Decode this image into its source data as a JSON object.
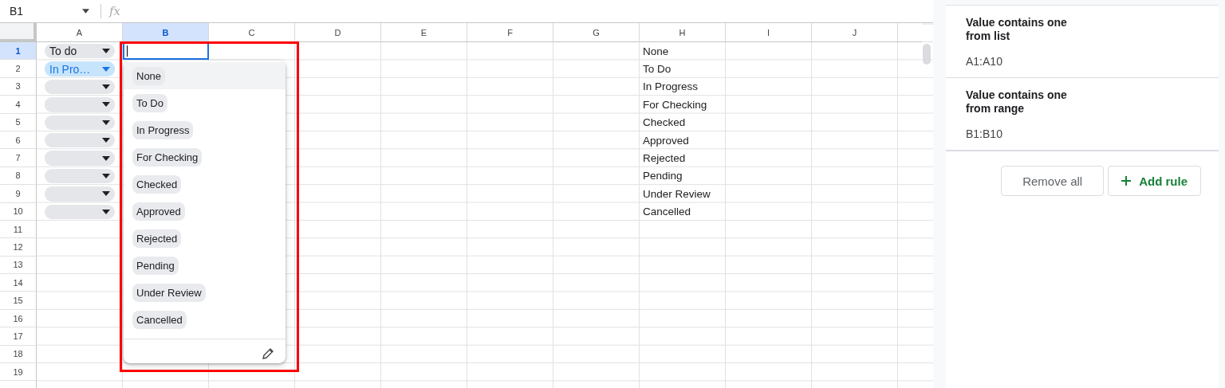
{
  "name_box": {
    "value": "B1"
  },
  "formula_bar": {
    "icon": "fx"
  },
  "columns": [
    {
      "label": "A",
      "selected": false
    },
    {
      "label": "B",
      "selected": true
    },
    {
      "label": "C",
      "selected": false
    },
    {
      "label": "D",
      "selected": false
    },
    {
      "label": "E",
      "selected": false
    },
    {
      "label": "F",
      "selected": false
    },
    {
      "label": "G",
      "selected": false
    },
    {
      "label": "H",
      "selected": false
    },
    {
      "label": "I",
      "selected": false
    },
    {
      "label": "J",
      "selected": false
    }
  ],
  "rows": [
    {
      "label": "1",
      "selected": true,
      "chip": {
        "value": "To do",
        "color": "#e4e6ea",
        "kind": "plain"
      },
      "editing": true,
      "h": "None"
    },
    {
      "label": "2",
      "selected": false,
      "chip": {
        "value": "In Pro…",
        "color": "#c6e4fb",
        "kind": "accent"
      },
      "editing": false,
      "h": "To Do"
    },
    {
      "label": "3",
      "selected": false,
      "chip": {
        "color": "#e4e6ea",
        "kind": "plain"
      },
      "editing": false,
      "h": "In Progress"
    },
    {
      "label": "4",
      "selected": false,
      "chip": {
        "color": "#e4e6ea",
        "kind": "plain"
      },
      "editing": false,
      "h": "For Checking"
    },
    {
      "label": "5",
      "selected": false,
      "chip": {
        "color": "#e4e6ea",
        "kind": "plain"
      },
      "editing": false,
      "h": "Checked"
    },
    {
      "label": "6",
      "selected": false,
      "chip": {
        "color": "#e4e6ea",
        "kind": "plain"
      },
      "editing": false,
      "h": "Approved"
    },
    {
      "label": "7",
      "selected": false,
      "chip": {
        "color": "#e4e6ea",
        "kind": "plain"
      },
      "editing": false,
      "h": "Rejected"
    },
    {
      "label": "8",
      "selected": false,
      "chip": {
        "color": "#e4e6ea",
        "kind": "plain"
      },
      "editing": false,
      "h": "Pending"
    },
    {
      "label": "9",
      "selected": false,
      "chip": {
        "color": "#e4e6ea",
        "kind": "plain"
      },
      "editing": false,
      "h": "Under Review"
    },
    {
      "label": "10",
      "selected": false,
      "chip": {
        "color": "#e4e6ea",
        "kind": "plain"
      },
      "editing": false,
      "h": "Cancelled"
    },
    {
      "label": "11",
      "selected": false,
      "editing": false
    },
    {
      "label": "12",
      "selected": false,
      "editing": false
    },
    {
      "label": "13",
      "selected": false,
      "editing": false
    },
    {
      "label": "14",
      "selected": false,
      "editing": false
    },
    {
      "label": "15",
      "selected": false,
      "editing": false
    },
    {
      "label": "16",
      "selected": false,
      "editing": false
    },
    {
      "label": "17",
      "selected": false,
      "editing": false
    },
    {
      "label": "18",
      "selected": false,
      "editing": false
    },
    {
      "label": "19",
      "selected": false,
      "editing": false
    }
  ],
  "dropdown": {
    "options": [
      {
        "label": "None",
        "selected": true
      },
      {
        "label": "To Do",
        "selected": false
      },
      {
        "label": "In Progress",
        "selected": false
      },
      {
        "label": "For Checking",
        "selected": false
      },
      {
        "label": "Checked",
        "selected": false
      },
      {
        "label": "Approved",
        "selected": false
      },
      {
        "label": "Rejected",
        "selected": false
      },
      {
        "label": "Pending",
        "selected": false
      },
      {
        "label": "Under Review",
        "selected": false
      },
      {
        "label": "Cancelled",
        "selected": false
      }
    ]
  },
  "side_panel": {
    "rules": [
      {
        "title": "Value contains one from list",
        "range": "A1:A10"
      },
      {
        "title": "Value contains one from range",
        "range": "B1:B10"
      }
    ],
    "buttons": [
      {
        "kind": "plain",
        "label": "Remove all"
      },
      {
        "kind": "add",
        "label": "Add rule"
      }
    ]
  }
}
